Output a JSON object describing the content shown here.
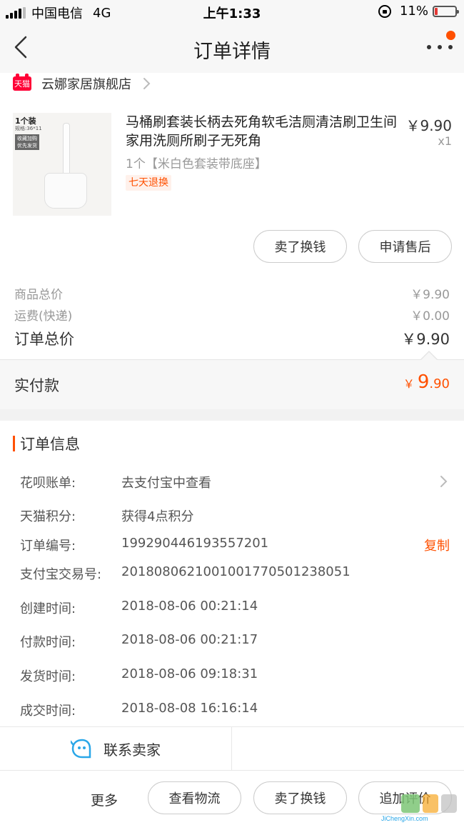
{
  "status_bar": {
    "carrier": "中国电信",
    "network": "4G",
    "time": "上午1:33",
    "battery": "11%"
  },
  "nav": {
    "title": "订单详情"
  },
  "shop": {
    "badge": "天猫",
    "name": "云娜家居旗舰店"
  },
  "product": {
    "image_text_1": "1个装",
    "image_text_2": "规格:36*11",
    "image_text_3": "收藏加购 优先发货",
    "title": "马桶刷套装长柄去死角软毛洁厕清洁刷卫生间家用洗厕所刷子无死角",
    "price": "￥9.90",
    "quantity": "x1",
    "sku": "1个【米白色套装带底座】",
    "badge": "七天退换"
  },
  "product_actions": {
    "sell_label": "卖了换钱",
    "aftersale_label": "申请售后"
  },
  "summary": {
    "goods_label": "商品总价",
    "goods_value": "￥9.90",
    "shipping_label": "运费(快递)",
    "shipping_value": "￥0.00",
    "total_label": "订单总价",
    "total_value": "￥9.90",
    "paid_label": "实付款",
    "paid_currency": "￥",
    "paid_int": "9",
    "paid_dec": ".90"
  },
  "order_info": {
    "title": "订单信息",
    "rows": [
      {
        "label": "花呗账单:",
        "value": "去支付宝中查看"
      },
      {
        "label": "天猫积分:",
        "value": "获得4点积分"
      },
      {
        "label": "订单编号:",
        "value": "199290446193557201",
        "action": "复制"
      },
      {
        "label": "支付宝交易号:",
        "value": "2018080621001001770501238051"
      },
      {
        "label": "创建时间:",
        "value": "2018-08-06 00:21:14"
      },
      {
        "label": "付款时间:",
        "value": "2018-08-06 00:21:17"
      },
      {
        "label": "发货时间:",
        "value": "2018-08-06 09:18:31"
      },
      {
        "label": "成交时间:",
        "value": "2018-08-08 16:16:14"
      }
    ]
  },
  "contact": {
    "label": "联系卖家"
  },
  "bottom": {
    "more_label": "更多",
    "logistics_label": "查看物流",
    "sell_label": "卖了换钱",
    "review_label": "追加评价"
  },
  "watermark": {
    "text": "JiChengXin.com"
  },
  "colors": {
    "accent": "#ff5000",
    "tmall_red": "#ff0036",
    "contact_blue": "#2aa7e8"
  }
}
